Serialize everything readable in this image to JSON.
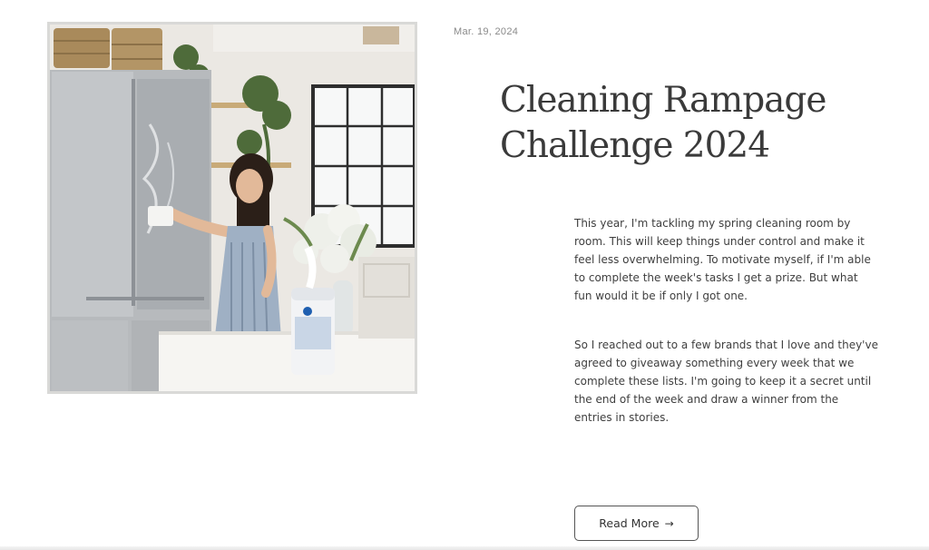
{
  "post": {
    "date": "Mar. 19, 2024",
    "title_line1": "Cleaning Rampage",
    "title_line2": "Challenge 2024",
    "paragraphs": [
      "This year, I'm tackling my spring cleaning room by room. This will keep things under control and make it feel less overwhelming. To motivate myself, if I'm able to complete the week's tasks I get a prize. But what fun would it be if only I got one.",
      "So I reached out to a few brands that I love and they've agreed to giveaway something every week that we complete these lists. I'm going to keep it a secret until the end of the week and draw a winner from the entries in stories."
    ],
    "read_more_label": "Read More",
    "read_more_icon": "arrow-right-icon"
  },
  "photo": {
    "subject": "woman wiping stainless steel refrigerator in kitchen",
    "colors": {
      "wall": "#ece9e4",
      "fridge": "#b9bcbf",
      "counter": "#f6f5f2",
      "window_frame": "#2e2e2e",
      "plants": "#4e6b3a",
      "dress": "#9fb0c4",
      "hair": "#2b1f18"
    }
  }
}
